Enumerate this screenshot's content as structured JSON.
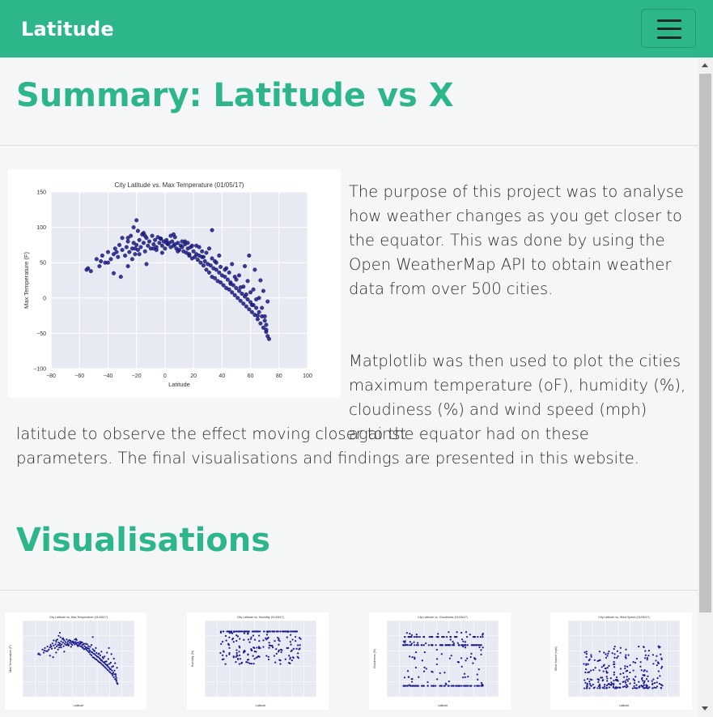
{
  "navbar": {
    "brand": "Latitude",
    "toggle_icon": "hamburger-icon"
  },
  "summary": {
    "title": "Summary: Latitude vs X",
    "paragraph1": "The purpose of this project was to analyse how weather changes as you get closer to the equator. This was done by using the Open WeatherMap API to obtain weather data from over 500 cities.",
    "paragraph2_wrap": "Matplotlib was then used to plot the cities maximum temperature (oF), humidity (%), cloudiness (%) and wind speed (mph) against",
    "paragraph2_rest": "latitude to observe the effect moving closer to the equator had on these parameters. The final visualisations and findings are presented in this website."
  },
  "visualisations": {
    "title": "Visualisations",
    "thumbnails": [
      {
        "title": "City Latitude vs. Max Temperature (01/05/17)",
        "ylabel": "Max Temperature (F)"
      },
      {
        "title": "City Latitude vs. Humidity (01/05/17)",
        "ylabel": "Humidity (%)"
      },
      {
        "title": "City Latitude vs. Cloudiness (01/05/17)",
        "ylabel": "Cloudiness (%)"
      },
      {
        "title": "City Latitude vs. Wind Speed (01/05/17)",
        "ylabel": "Wind Speed (mph)"
      }
    ]
  },
  "colors": {
    "accent": "#2db68a",
    "marker": "#1a1a8c",
    "plot_bg": "#e8eaf3"
  },
  "chart_data": {
    "type": "scatter",
    "title": "City Latitude vs. Max Temperature (01/05/17)",
    "xlabel": "Latitude",
    "ylabel": "Max Temperature (F)",
    "xlim": [
      -80,
      100
    ],
    "ylim": [
      -100,
      150
    ],
    "xticks": [
      -80,
      -60,
      -40,
      -20,
      0,
      20,
      40,
      60,
      80,
      100
    ],
    "yticks": [
      -100,
      -50,
      0,
      50,
      100,
      150
    ],
    "grid": true,
    "x": [
      -55,
      -54,
      -52,
      -48,
      -46,
      -45,
      -44,
      -42,
      -40,
      -38,
      -36,
      -35,
      -33,
      -32,
      -30,
      -30,
      -28,
      -27,
      -26,
      -25,
      -24,
      -23,
      -22,
      -22,
      -21,
      -20,
      -20,
      -19,
      -18,
      -17,
      -16,
      -15,
      -14,
      -13,
      -12,
      -11,
      -10,
      -9,
      -8,
      -7,
      -6,
      -5,
      -4,
      -3,
      -2,
      -1,
      0,
      1,
      2,
      3,
      4,
      5,
      6,
      7,
      8,
      9,
      10,
      11,
      12,
      13,
      14,
      15,
      16,
      17,
      18,
      19,
      20,
      21,
      22,
      23,
      24,
      25,
      26,
      27,
      28,
      29,
      30,
      31,
      32,
      33,
      34,
      35,
      36,
      37,
      38,
      39,
      40,
      41,
      42,
      43,
      44,
      45,
      46,
      47,
      48,
      49,
      50,
      51,
      52,
      53,
      54,
      55,
      56,
      57,
      58,
      59,
      60,
      61,
      62,
      63,
      64,
      65,
      66,
      67,
      68,
      69,
      70,
      71,
      72,
      -36,
      -31,
      -23,
      -18,
      -13,
      -6,
      -3,
      1,
      6,
      9,
      14,
      17,
      22,
      27,
      31,
      36,
      38,
      43,
      47,
      52,
      58,
      62,
      66,
      71,
      -40,
      -34,
      -26,
      -15,
      -8,
      4,
      12,
      19,
      26,
      33,
      39,
      45,
      50,
      55,
      60,
      64,
      68,
      70,
      33,
      42,
      49,
      56,
      59,
      63,
      67,
      69,
      72,
      46,
      53,
      57,
      61,
      65,
      71,
      73,
      -26,
      -21,
      -19,
      -14,
      -2,
      7,
      16,
      24,
      29,
      35
    ],
    "y": [
      40,
      42,
      38,
      55,
      45,
      52,
      60,
      50,
      65,
      55,
      62,
      70,
      58,
      75,
      68,
      85,
      60,
      72,
      80,
      65,
      88,
      70,
      78,
      100,
      62,
      75,
      110,
      68,
      82,
      72,
      90,
      78,
      66,
      85,
      74,
      80,
      70,
      88,
      76,
      82,
      72,
      86,
      78,
      84,
      74,
      80,
      70,
      82,
      76,
      78,
      72,
      80,
      74,
      76,
      70,
      78,
      68,
      74,
      72,
      66,
      76,
      64,
      70,
      60,
      72,
      56,
      66,
      58,
      62,
      54,
      60,
      50,
      58,
      46,
      52,
      40,
      48,
      36,
      46,
      30,
      42,
      28,
      40,
      24,
      36,
      22,
      32,
      18,
      30,
      14,
      26,
      12,
      22,
      8,
      18,
      4,
      14,
      0,
      10,
      -4,
      6,
      -8,
      2,
      -12,
      -2,
      -16,
      -6,
      -20,
      -10,
      -24,
      -14,
      -30,
      -20,
      -36,
      -26,
      -42,
      -32,
      -48,
      -54,
      35,
      30,
      55,
      62,
      48,
      68,
      84,
      78,
      90,
      66,
      80,
      62,
      74,
      58,
      70,
      50,
      60,
      42,
      48,
      32,
      24,
      12,
      0,
      -38,
      50,
      65,
      85,
      92,
      70,
      88,
      80,
      74,
      66,
      56,
      44,
      36,
      26,
      16,
      8,
      -2,
      -14,
      -26,
      96,
      40,
      30,
      45,
      60,
      40,
      25,
      10,
      -5,
      20,
      15,
      5,
      -10,
      -25,
      -45,
      -58,
      45,
      70,
      95,
      88,
      64,
      86,
      78,
      72,
      64,
      52
    ]
  }
}
